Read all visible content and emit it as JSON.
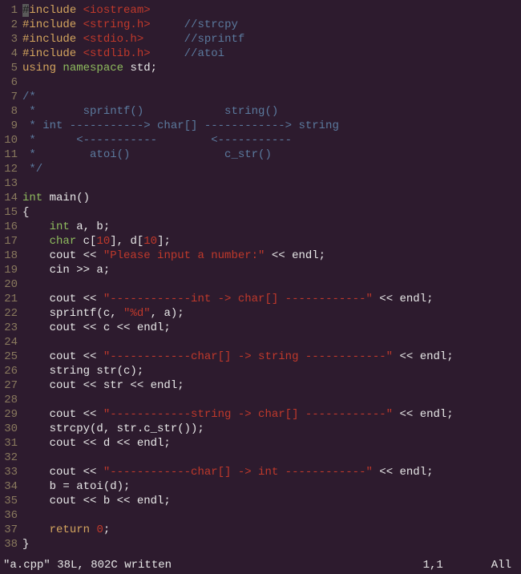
{
  "lines": [
    {
      "n": "1",
      "segments": [
        {
          "cls": "tk-preproc cursor",
          "t": "#"
        },
        {
          "cls": "tk-preproc",
          "t": "include "
        },
        {
          "cls": "tk-include",
          "t": "<iostream>"
        }
      ]
    },
    {
      "n": "2",
      "segments": [
        {
          "cls": "tk-preproc",
          "t": "#include "
        },
        {
          "cls": "tk-include",
          "t": "<string.h>"
        },
        {
          "cls": "tk-default",
          "t": "     "
        },
        {
          "cls": "tk-comment",
          "t": "//strcpy"
        }
      ]
    },
    {
      "n": "3",
      "segments": [
        {
          "cls": "tk-preproc",
          "t": "#include "
        },
        {
          "cls": "tk-include",
          "t": "<stdio.h>"
        },
        {
          "cls": "tk-default",
          "t": "      "
        },
        {
          "cls": "tk-comment",
          "t": "//sprintf"
        }
      ]
    },
    {
      "n": "4",
      "segments": [
        {
          "cls": "tk-preproc",
          "t": "#include "
        },
        {
          "cls": "tk-include",
          "t": "<stdlib.h>"
        },
        {
          "cls": "tk-default",
          "t": "     "
        },
        {
          "cls": "tk-comment",
          "t": "//atoi"
        }
      ]
    },
    {
      "n": "5",
      "segments": [
        {
          "cls": "tk-keyword",
          "t": "using"
        },
        {
          "cls": "tk-default",
          "t": " "
        },
        {
          "cls": "tk-namespace",
          "t": "namespace"
        },
        {
          "cls": "tk-default",
          "t": " std;"
        }
      ]
    },
    {
      "n": "6",
      "segments": [
        {
          "cls": "tk-default",
          "t": ""
        }
      ]
    },
    {
      "n": "7",
      "segments": [
        {
          "cls": "tk-comment",
          "t": "/*"
        }
      ]
    },
    {
      "n": "8",
      "segments": [
        {
          "cls": "tk-comment",
          "t": " *       sprintf()            string()"
        }
      ]
    },
    {
      "n": "9",
      "segments": [
        {
          "cls": "tk-comment",
          "t": " * int -----------> char[] ------------> string"
        }
      ]
    },
    {
      "n": "10",
      "segments": [
        {
          "cls": "tk-comment",
          "t": " *      <-----------        <-----------"
        }
      ]
    },
    {
      "n": "11",
      "segments": [
        {
          "cls": "tk-comment",
          "t": " *        atoi()              c_str()"
        }
      ]
    },
    {
      "n": "12",
      "segments": [
        {
          "cls": "tk-comment",
          "t": " */"
        }
      ]
    },
    {
      "n": "13",
      "segments": [
        {
          "cls": "tk-default",
          "t": ""
        }
      ]
    },
    {
      "n": "14",
      "segments": [
        {
          "cls": "tk-type",
          "t": "int"
        },
        {
          "cls": "tk-default",
          "t": " main()"
        }
      ]
    },
    {
      "n": "15",
      "segments": [
        {
          "cls": "tk-default",
          "t": "{"
        }
      ]
    },
    {
      "n": "16",
      "segments": [
        {
          "cls": "tk-default",
          "t": "    "
        },
        {
          "cls": "tk-type",
          "t": "int"
        },
        {
          "cls": "tk-default",
          "t": " a, b;"
        }
      ]
    },
    {
      "n": "17",
      "segments": [
        {
          "cls": "tk-default",
          "t": "    "
        },
        {
          "cls": "tk-type",
          "t": "char"
        },
        {
          "cls": "tk-default",
          "t": " c["
        },
        {
          "cls": "tk-number",
          "t": "10"
        },
        {
          "cls": "tk-default",
          "t": "], d["
        },
        {
          "cls": "tk-number",
          "t": "10"
        },
        {
          "cls": "tk-default",
          "t": "];"
        }
      ]
    },
    {
      "n": "18",
      "segments": [
        {
          "cls": "tk-default",
          "t": "    cout << "
        },
        {
          "cls": "tk-string",
          "t": "\"Please input a number:\""
        },
        {
          "cls": "tk-default",
          "t": " << endl;"
        }
      ]
    },
    {
      "n": "19",
      "segments": [
        {
          "cls": "tk-default",
          "t": "    cin >> a;"
        }
      ]
    },
    {
      "n": "20",
      "segments": [
        {
          "cls": "tk-default",
          "t": ""
        }
      ]
    },
    {
      "n": "21",
      "segments": [
        {
          "cls": "tk-default",
          "t": "    cout << "
        },
        {
          "cls": "tk-string",
          "t": "\"------------int -> char[] ------------\""
        },
        {
          "cls": "tk-default",
          "t": " << endl;"
        }
      ]
    },
    {
      "n": "22",
      "segments": [
        {
          "cls": "tk-default",
          "t": "    sprintf(c, "
        },
        {
          "cls": "tk-string",
          "t": "\"%d\""
        },
        {
          "cls": "tk-default",
          "t": ", a);"
        }
      ]
    },
    {
      "n": "23",
      "segments": [
        {
          "cls": "tk-default",
          "t": "    cout << c << endl;"
        }
      ]
    },
    {
      "n": "24",
      "segments": [
        {
          "cls": "tk-default",
          "t": ""
        }
      ]
    },
    {
      "n": "25",
      "segments": [
        {
          "cls": "tk-default",
          "t": "    cout << "
        },
        {
          "cls": "tk-string",
          "t": "\"------------char[] -> string ------------\""
        },
        {
          "cls": "tk-default",
          "t": " << endl;"
        }
      ]
    },
    {
      "n": "26",
      "segments": [
        {
          "cls": "tk-default",
          "t": "    string str(c);"
        }
      ]
    },
    {
      "n": "27",
      "segments": [
        {
          "cls": "tk-default",
          "t": "    cout << str << endl;"
        }
      ]
    },
    {
      "n": "28",
      "segments": [
        {
          "cls": "tk-default",
          "t": ""
        }
      ]
    },
    {
      "n": "29",
      "segments": [
        {
          "cls": "tk-default",
          "t": "    cout << "
        },
        {
          "cls": "tk-string",
          "t": "\"------------string -> char[] ------------\""
        },
        {
          "cls": "tk-default",
          "t": " << endl;"
        }
      ]
    },
    {
      "n": "30",
      "segments": [
        {
          "cls": "tk-default",
          "t": "    strcpy(d, str.c_str());"
        }
      ]
    },
    {
      "n": "31",
      "segments": [
        {
          "cls": "tk-default",
          "t": "    cout << d << endl;"
        }
      ]
    },
    {
      "n": "32",
      "segments": [
        {
          "cls": "tk-default",
          "t": ""
        }
      ]
    },
    {
      "n": "33",
      "segments": [
        {
          "cls": "tk-default",
          "t": "    cout << "
        },
        {
          "cls": "tk-string",
          "t": "\"------------char[] -> int ------------\""
        },
        {
          "cls": "tk-default",
          "t": " << endl;"
        }
      ]
    },
    {
      "n": "34",
      "segments": [
        {
          "cls": "tk-default",
          "t": "    b = atoi(d);"
        }
      ]
    },
    {
      "n": "35",
      "segments": [
        {
          "cls": "tk-default",
          "t": "    cout << b << endl;"
        }
      ]
    },
    {
      "n": "36",
      "segments": [
        {
          "cls": "tk-default",
          "t": ""
        }
      ]
    },
    {
      "n": "37",
      "segments": [
        {
          "cls": "tk-default",
          "t": "    "
        },
        {
          "cls": "tk-keyword",
          "t": "return"
        },
        {
          "cls": "tk-default",
          "t": " "
        },
        {
          "cls": "tk-number",
          "t": "0"
        },
        {
          "cls": "tk-default",
          "t": ";"
        }
      ]
    },
    {
      "n": "38",
      "segments": [
        {
          "cls": "tk-default",
          "t": "}"
        }
      ]
    }
  ],
  "status": {
    "message": "\"a.cpp\" 38L, 802C written",
    "position": "1,1",
    "percent": "All"
  }
}
